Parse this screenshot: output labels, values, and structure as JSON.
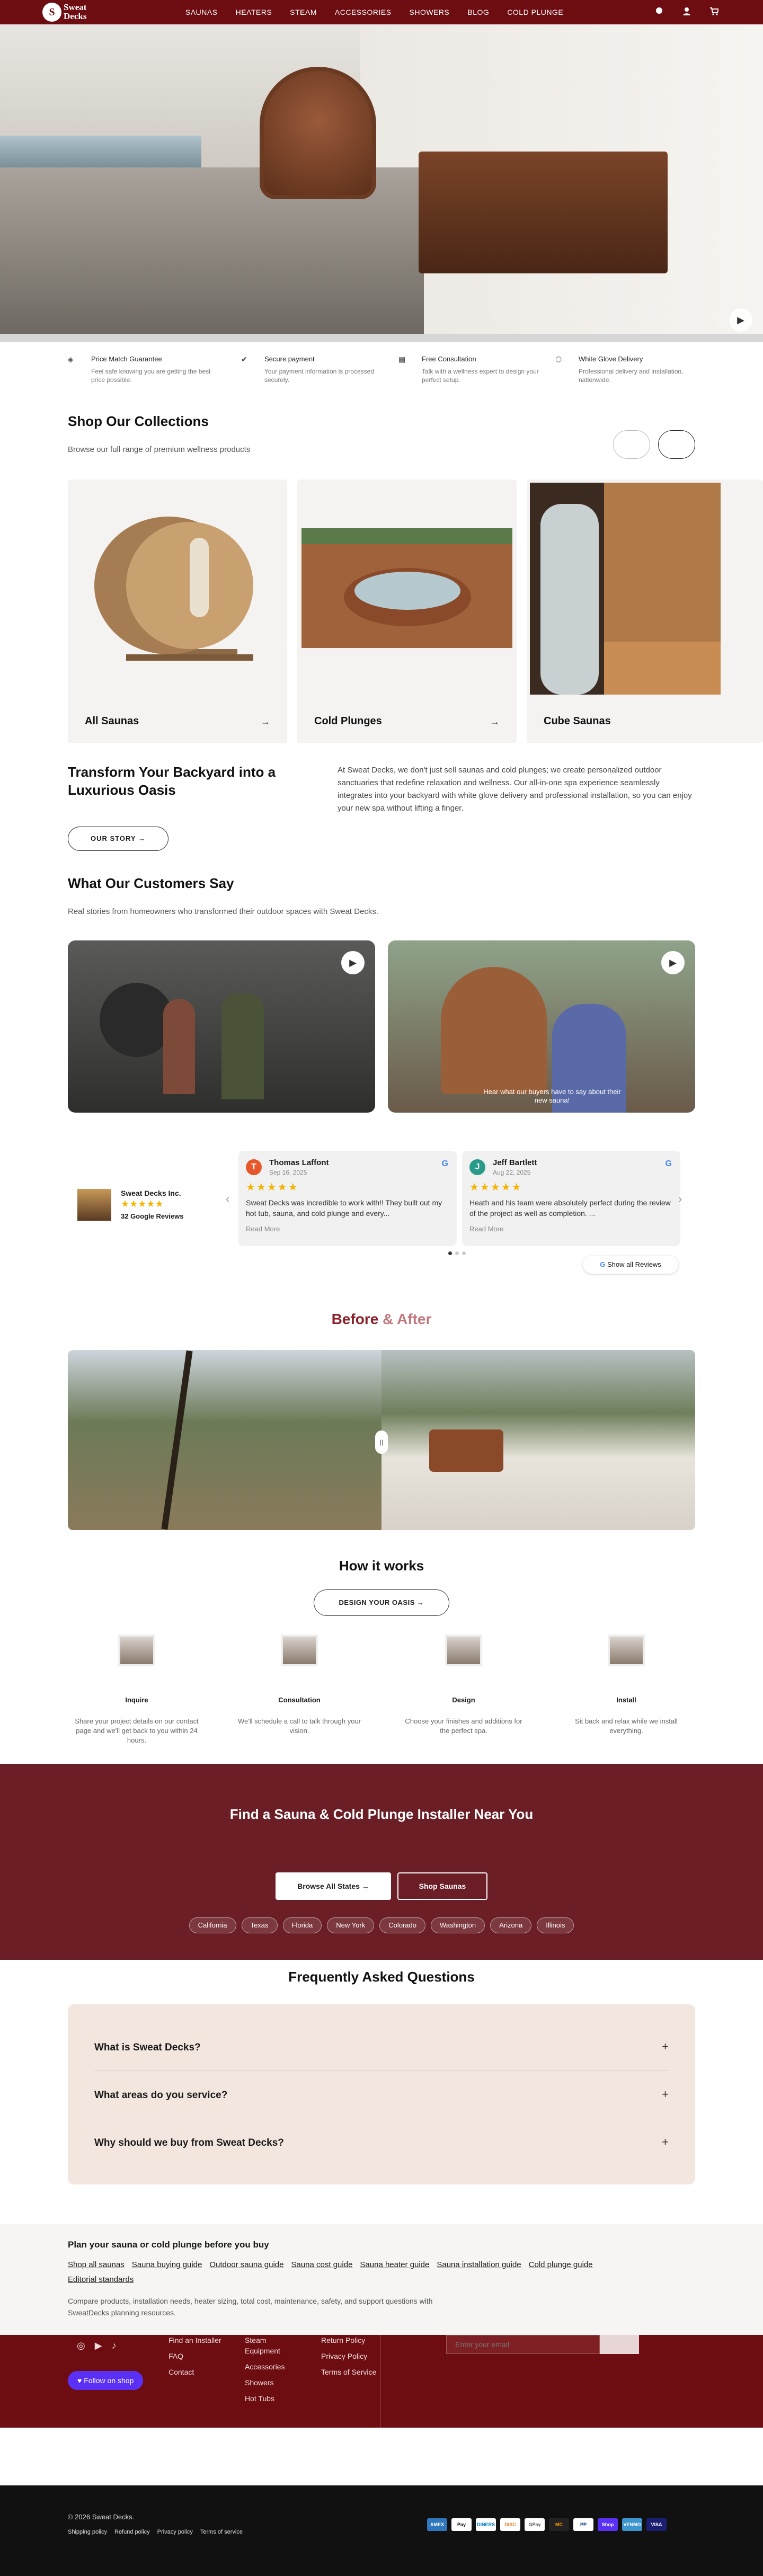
{
  "nav": {
    "brand_line1": "Sweat",
    "brand_line2": "Decks",
    "logo_letter": "S",
    "items": [
      "SAUNAS",
      "HEATERS",
      "STEAM",
      "ACCESSORIES",
      "SHOWERS",
      "BLOG",
      "COLD PLUNGE"
    ]
  },
  "features": [
    {
      "title": "Price Match Guarantee",
      "desc": "Feel safe knowing you are getting the best price possible.",
      "icon": "tag-icon"
    },
    {
      "title": "Secure payment",
      "desc": "Your payment information is processed securely.",
      "icon": "check-shield-icon"
    },
    {
      "title": "Free Consultation",
      "desc": "Talk with a wellness expert to design your perfect setup.",
      "icon": "chat-icon"
    },
    {
      "title": "White Glove Delivery",
      "desc": "Professional delivery and installation, nationwide.",
      "icon": "box-icon"
    }
  ],
  "collections": {
    "title": "Shop Our Collections",
    "subtitle": "Browse our full range of premium wellness products",
    "cards": [
      "All Saunas",
      "Cold Plunges",
      "Cube Saunas"
    ]
  },
  "transform": {
    "title": "Transform Your Backyard into a Luxurious Oasis",
    "body": "At Sweat Decks, we don't just sell saunas and cold plunges; we create personalized outdoor sanctuaries that redefine relaxation and wellness. Our all-in-one spa experience seamlessly integrates into your backyard with white glove delivery and professional installation, so you can enjoy your new spa without lifting a finger.",
    "button": "OUR STORY"
  },
  "customers": {
    "title": "What Our Customers Say",
    "subtitle": "Real stories from homeowners who transformed their outdoor spaces with Sweat Decks.",
    "video2_caption": "Hear what our buyers have to say about their new sauna!"
  },
  "google": {
    "name": "Sweat Decks Inc.",
    "stars": "★★★★★",
    "count": "32 Google Reviews",
    "show_all": "Show all Reviews"
  },
  "reviews": [
    {
      "initial": "T",
      "name": "Thomas Laffont",
      "date": "Sep 16, 2025",
      "stars": "★★★★★",
      "text": "Sweat Decks was incredible to work with!! They built out my hot tub, sauna, and cold plunge and every...",
      "more": "Read More",
      "color": "#e8572a"
    },
    {
      "initial": "J",
      "name": "Jeff Bartlett",
      "date": "Aug 22, 2025",
      "stars": "★★★★★",
      "text": "Heath and his team were absolutely perfect during the review of the project as well as completion. ...",
      "more": "Read More",
      "color": "#2a9a8a"
    }
  ],
  "before_after": {
    "title_a": "Before",
    "title_amp": " & ",
    "title_b": "After"
  },
  "how": {
    "title": "How it works",
    "button": "DESIGN YOUR OASIS",
    "steps": [
      {
        "title": "Inquire",
        "desc": "Share your project details on our contact page and we'll get back to you within 24 hours."
      },
      {
        "title": "Consultation",
        "desc": "We'll schedule a call to talk through your vision."
      },
      {
        "title": "Design",
        "desc": "Choose your finishes and additions for the perfect spa."
      },
      {
        "title": "Install",
        "desc": "Sit back and relax while we install everything."
      }
    ]
  },
  "finder": {
    "title": "Find a Sauna & Cold Plunge Installer Near You",
    "btn1": "Browse All States →",
    "btn2": "Shop Saunas",
    "states": [
      "California",
      "Texas",
      "Florida",
      "New York",
      "Colorado",
      "Washington",
      "Arizona",
      "Illinois"
    ]
  },
  "faq": {
    "title": "Frequently Asked Questions",
    "items": [
      "What is Sweat Decks?",
      "What areas do you service?",
      "Why should we buy from Sweat Decks?"
    ]
  },
  "plan": {
    "title": "Plan your sauna or cold plunge before you buy",
    "links": [
      "Shop all saunas",
      "Sauna buying guide",
      "Outdoor sauna guide",
      "Sauna cost guide",
      "Sauna heater guide",
      "Sauna installation guide",
      "Cold plunge guide",
      "Editorial standards"
    ],
    "desc": "Compare products, installation needs, heater sizing, total cost, maintenance, safety, and support questions with SweatDecks planning resources."
  },
  "footer": {
    "follow": "Follow on shop",
    "col1": [
      "Find an Installer",
      "FAQ",
      "Contact"
    ],
    "col2": [
      "Steam Equipment",
      "Accessories",
      "Showers",
      "Hot Tubs"
    ],
    "col3": [
      "Return Policy",
      "Privacy Policy",
      "Terms of Service"
    ],
    "email_placeholder": "Enter your email"
  },
  "bottom": {
    "copyright": "© 2026 Sweat Decks.",
    "links": [
      "Shipping policy",
      "Refund policy",
      "Privacy policy",
      "Terms of service"
    ],
    "payments": [
      "AMEX",
      "Pay",
      "DINERS",
      "DISC",
      "GPay",
      "MC",
      "PP",
      "Shop",
      "VENMO",
      "VISA"
    ]
  }
}
